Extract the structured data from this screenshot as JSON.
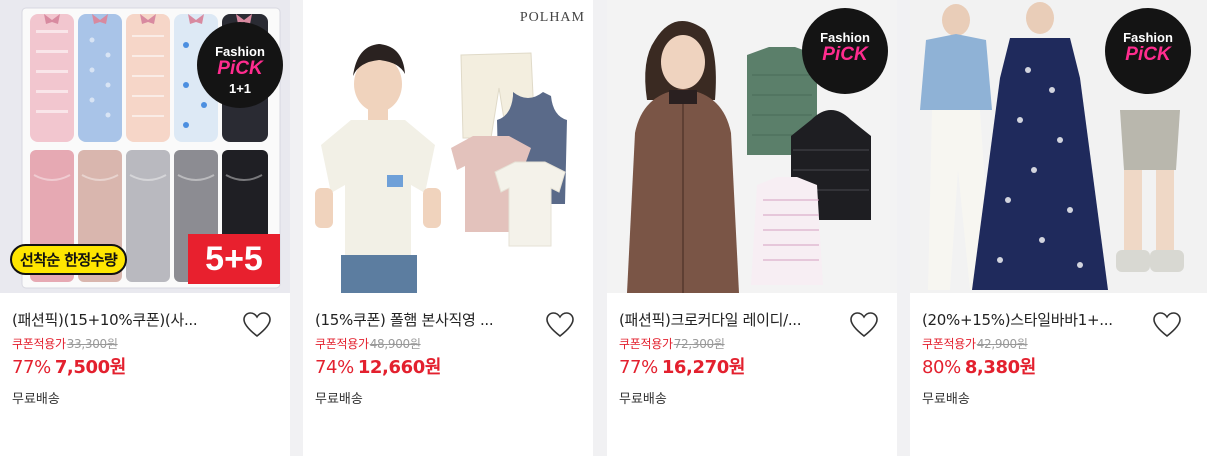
{
  "products": [
    {
      "title": "(패션픽)(15+10%쿠폰)(사...",
      "coupon_label": "쿠폰적용가",
      "original_price": "33,300원",
      "discount": "77%",
      "price": "7,500원",
      "shipping": "무료배송",
      "badge": {
        "line1": "Fashion",
        "line2": "PiCK",
        "line3": "1+1"
      },
      "promo_tag": "선착순 한정수량",
      "promo_count": "5+5"
    },
    {
      "title": "(15%쿠폰) 폴햄 본사직영 ...",
      "coupon_label": "쿠폰적용가",
      "original_price": "48,900원",
      "discount": "74%",
      "price": "12,660원",
      "shipping": "무료배송",
      "brand": "POLHAM"
    },
    {
      "title": "(패션픽)크로커다일 레이디/...",
      "coupon_label": "쿠폰적용가",
      "original_price": "72,300원",
      "discount": "77%",
      "price": "16,270원",
      "shipping": "무료배송",
      "badge": {
        "line1": "Fashion",
        "line2": "PiCK"
      }
    },
    {
      "title": "(20%+15%)스타일바바1+...",
      "coupon_label": "쿠폰적용가",
      "original_price": "42,900원",
      "discount": "80%",
      "price": "8,380원",
      "shipping": "무료배송",
      "badge": {
        "line1": "Fashion",
        "line2": "PiCK"
      }
    }
  ],
  "colors": {
    "accent_red": "#e3202e",
    "badge_pink": "#ff2c8e"
  }
}
